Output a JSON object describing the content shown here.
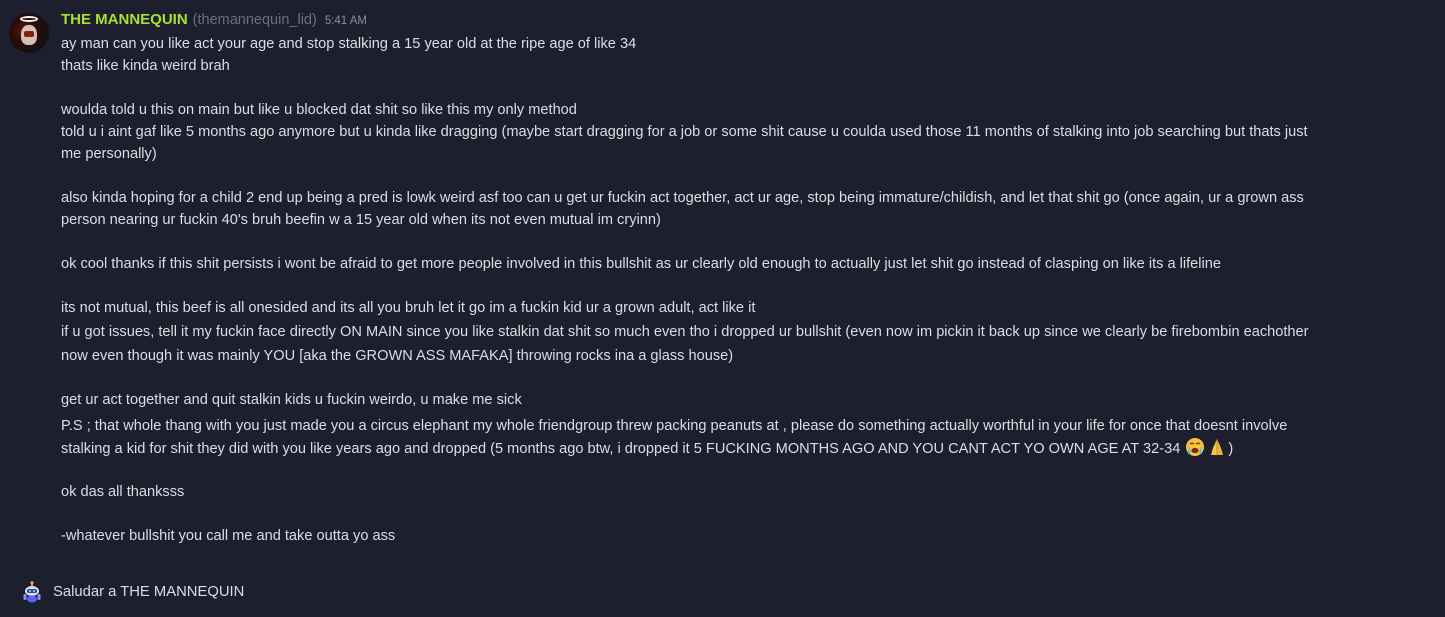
{
  "message": {
    "author": {
      "display_name": "THE MANNEQUIN",
      "handle": "(themannequin_lid)",
      "name_color": "#a6e22e"
    },
    "timestamp": "5:41 AM",
    "lines": [
      "ay man can you like act your age and stop stalking a 15 year old at the ripe age of like 34",
      "thats like kinda weird brah",
      "woulda told u this on main but like u blocked dat shit so like this my only method",
      "told u i aint gaf like 5 months ago anymore but u kinda like dragging (maybe start dragging for a job or some shit cause u coulda used those 11 months of stalking into job searching but thats just",
      "me personally)",
      "also kinda hoping for a child 2 end up being a pred is lowk weird asf too can u get ur fuckin act together, act ur age, stop being immature/childish, and let that shit go (once again, ur a grown ass",
      "person nearing ur fuckin 40's bruh beefin w a 15 year old when its not even mutual im cryinn)",
      "ok cool thanks if this shit persists i wont be afraid to get more people involved in this bullshit as ur clearly old enough to actually just let shit go instead of clasping on like its a lifeline",
      "its not mutual, this beef is all onesided and its all you bruh let it go im a fuckin kid ur a grown adult, act like it",
      "if u got issues, tell it my fuckin face directly ON MAIN since you like stalkin dat shit so much even tho i dropped ur bullshit (even now im pickin it back up since we clearly be firebombin eachother",
      "now even though it was mainly YOU [aka the GROWN ASS MAFAKA] throwing rocks ina a glass house)",
      "get ur act together and quit stalkin kids u fuckin weirdo, u make me sick",
      "P.S ; that whole thang with you just made you a circus elephant my whole friendgroup threw packing peanuts at , please do something actually worthful in your life for once that doesnt involve",
      "stalking a kid for shit they did with you like years ago and dropped (5 months ago btw, i dropped it 5 FUCKING MONTHS AGO AND YOU CANT ACT YO OWN AGE AT 32-34",
      ")",
      "ok das all thanksss",
      "-whatever bullshit you call me and take outta yo ass"
    ],
    "emojis": [
      "loudly-crying-face-icon",
      "folded-hands-icon"
    ]
  },
  "wave_prompt": {
    "label": "Saludar a THE MANNEQUIN",
    "icon": "wave-robot-icon"
  },
  "colors": {
    "background": "#1e1f2e",
    "text": "#dbdee1",
    "muted": "#6d6f78"
  }
}
